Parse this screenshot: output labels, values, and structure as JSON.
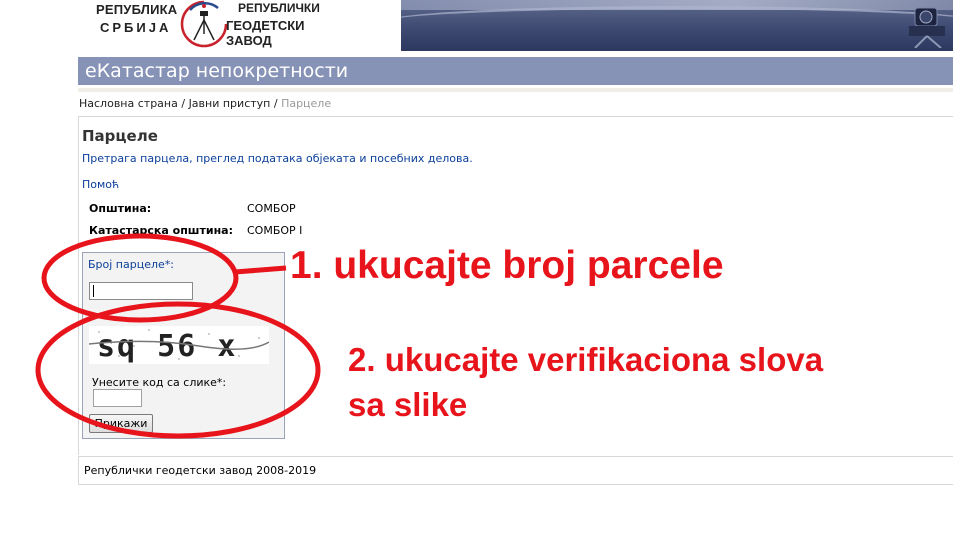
{
  "header": {
    "rs_line1": "РЕПУБЛИКА",
    "rs_line2": "СРБИЈА",
    "rgz_line1": "РЕПУБЛИЧКИ",
    "rgz_line2": "ГЕОДЕТСКИ ЗАВОД"
  },
  "title_bar": "еКатастар непокретности",
  "breadcrumb": {
    "home": "Насловна страна",
    "sep1": " / ",
    "public": "Јавни приступ",
    "sep2": " / ",
    "current": "Парцеле"
  },
  "page": {
    "title": "Парцеле",
    "subtitle": "Претрага парцела, преглед података објеката и посебних делова.",
    "help": "Помоћ"
  },
  "fields": {
    "municipality_label": "Општина:",
    "municipality_value": "СОМБОР",
    "cadastral_label": "Катастарска општина:",
    "cadastral_value": "СОМБОР I"
  },
  "form": {
    "parcel_label": "Број парцеле*:",
    "parcel_value": "",
    "captcha_text": "sq 56 x",
    "code_label": "Унесите код са слике*:",
    "code_value": "",
    "submit_label": "Прикажи"
  },
  "footer": "Републички геодетски завод 2008-2019",
  "annotations": {
    "step1": "1. ukucajte broj parcele",
    "step2_line1": "2. ukucajte verifikaciona slova",
    "step2_line2": "sa slike",
    "color": "#e8141b"
  },
  "colors": {
    "title_bar": "#8793b6",
    "link": "#0b3f9a"
  }
}
